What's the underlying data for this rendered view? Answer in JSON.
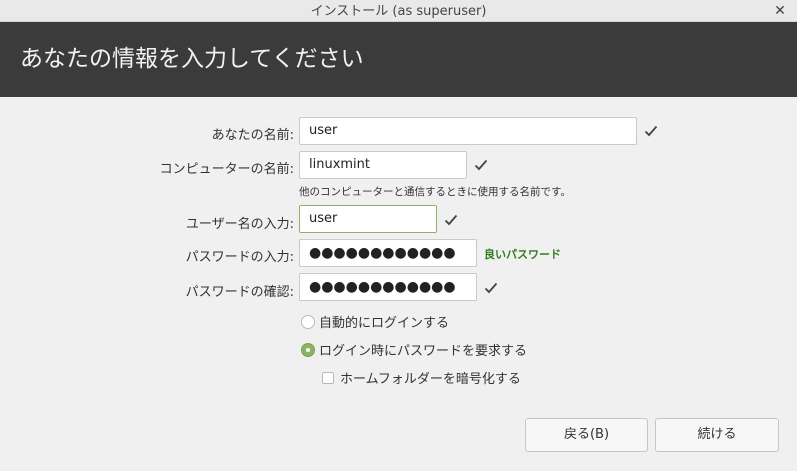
{
  "window": {
    "title": "インストール (as superuser)"
  },
  "header": {
    "title": "あなたの情報を入力してください"
  },
  "form": {
    "your_name": {
      "label": "あなたの名前:",
      "value": "user"
    },
    "computer_name": {
      "label": "コンピューターの名前:",
      "value": "linuxmint",
      "hint": "他のコンピューターと通信するときに使用する名前です。"
    },
    "username": {
      "label": "ユーザー名の入力:",
      "value": "user"
    },
    "password": {
      "label": "パスワードの入力:",
      "masked": "●●●●●●●●●●●●",
      "strength": "良いパスワード"
    },
    "confirm_password": {
      "label": "パスワードの確認:",
      "masked": "●●●●●●●●●●●●"
    },
    "login_options": [
      {
        "label": "自動的にログインする",
        "selected": false
      },
      {
        "label": "ログイン時にパスワードを要求する",
        "selected": true
      }
    ],
    "encrypt_home": {
      "label": "ホームフォルダーを暗号化する",
      "checked": false
    }
  },
  "buttons": {
    "back": "戻る(B)",
    "continue": "続ける"
  },
  "colors": {
    "header_bg": "#3b3b3b",
    "accent": "#8cb362",
    "strength_text": "#2e7d1a"
  },
  "icons": {
    "close": "close-icon",
    "valid": "checkmark-icon"
  }
}
